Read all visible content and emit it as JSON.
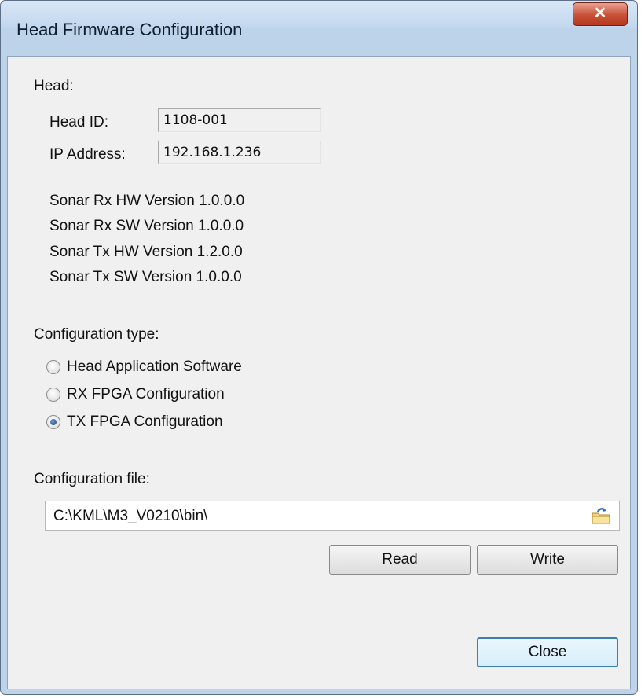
{
  "window": {
    "title": "Head Firmware Configuration",
    "close_glyph": "✕"
  },
  "head": {
    "section_label": "Head:",
    "head_id_label": "Head ID:",
    "head_id_value": "1108-001",
    "ip_label": "IP Address:",
    "ip_value": "192.168.1.236"
  },
  "versions": [
    "Sonar Rx HW Version 1.0.0.0",
    "Sonar Rx SW Version 1.0.0.0",
    "Sonar Tx HW Version 1.2.0.0",
    "Sonar Tx SW Version 1.0.0.0"
  ],
  "config_type": {
    "label": "Configuration type:",
    "options": [
      {
        "label": "Head Application Software",
        "checked": false
      },
      {
        "label": "RX FPGA Configuration",
        "checked": false
      },
      {
        "label": "TX FPGA Configuration",
        "checked": true
      }
    ]
  },
  "config_file": {
    "label": "Configuration file:",
    "value": "C:\\KML\\M3_V0210\\bin\\",
    "browse_icon": "folder-browse-icon"
  },
  "buttons": {
    "read": "Read",
    "write": "Write",
    "close": "Close"
  }
}
